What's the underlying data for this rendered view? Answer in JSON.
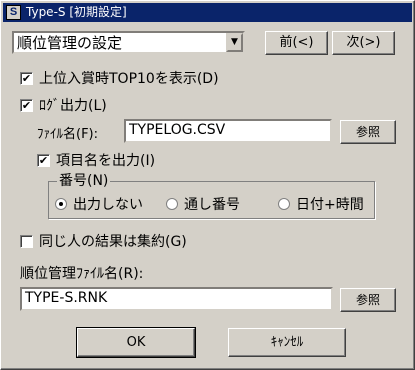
{
  "window": {
    "title": "Type-S [初期設定]",
    "icon": "S"
  },
  "header": {
    "combo_value": "順位管理の設定",
    "prev_label": "前(<)",
    "next_label": "次(>)"
  },
  "options": {
    "top10_label": "上位入賞時TOP10を表示(D)",
    "top10_checked": true,
    "log_output_label": "ﾛｸﾞ出力(L)",
    "log_output_checked": true,
    "filename_label": "ﾌｧｲﾙ名(F):",
    "filename_value": "TYPELOG.CSV",
    "browse_label": "参照",
    "item_names_label": "項目名を出力(I)",
    "item_names_checked": true,
    "number_group_label": "番号(N)",
    "radio_none": "出力しない",
    "radio_serial": "通し番号",
    "radio_datetime": "日付+時間",
    "selected_radio": "出力しない",
    "aggregate_label": "同じ人の結果は集約(G)",
    "aggregate_checked": false,
    "rank_file_label": "順位管理ﾌｧｲﾙ名(R):",
    "rank_file_value": "TYPE-S.RNK",
    "rank_browse_label": "参照"
  },
  "footer": {
    "ok_label": "OK",
    "cancel_label": "ｷｬﾝｾﾙ"
  },
  "check_mark": "✔"
}
